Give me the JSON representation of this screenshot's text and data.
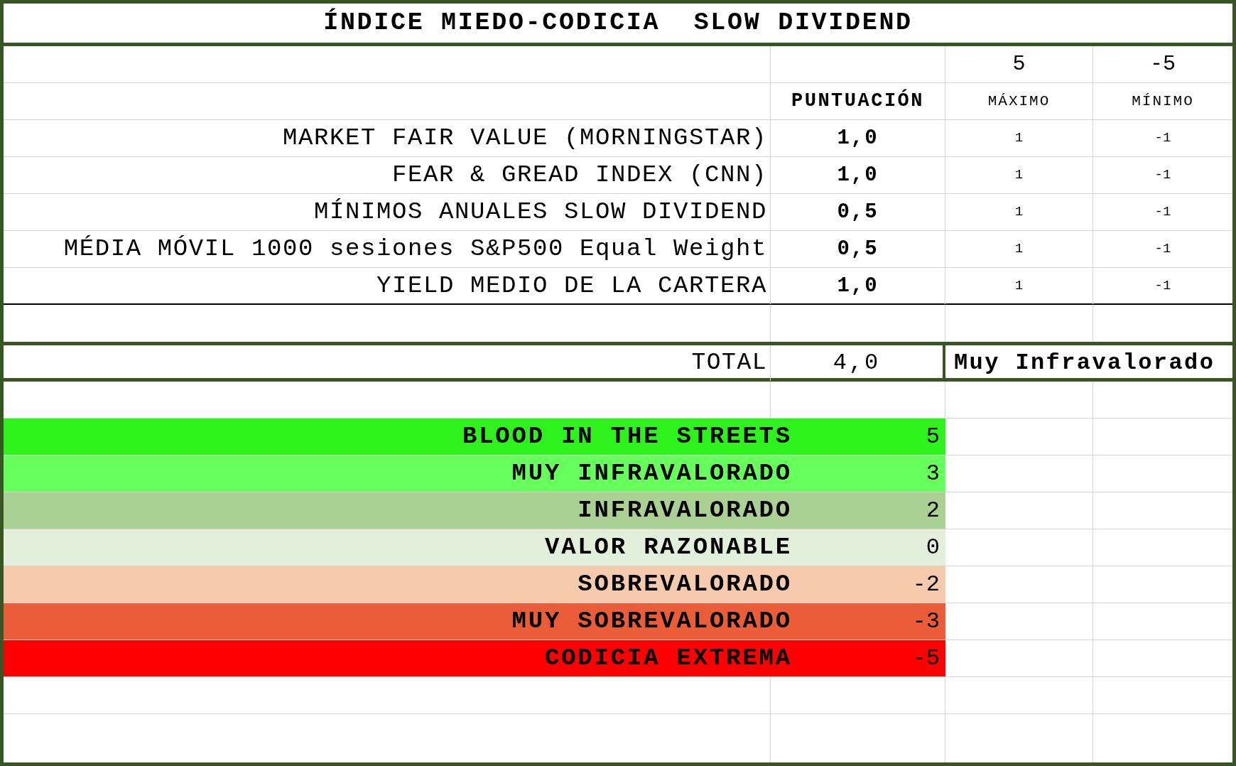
{
  "title": "ÍNDICE MIEDO-CODICIA  SLOW DIVIDEND",
  "header": {
    "max_value": "5",
    "min_value": "-5",
    "score_label": "PUNTUACIÓN",
    "max_label": "MÁXIMO",
    "min_label": "MÍNIMO"
  },
  "indicators": [
    {
      "name": "MARKET FAIR VALUE (MORNINGSTAR)",
      "score": "1,0",
      "max": "1",
      "min": "-1"
    },
    {
      "name": "FEAR & GREAD INDEX (CNN)",
      "score": "1,0",
      "max": "1",
      "min": "-1"
    },
    {
      "name": "MÍNIMOS ANUALES SLOW DIVIDEND",
      "score": "0,5",
      "max": "1",
      "min": "-1"
    },
    {
      "name": "MÉDIA MÓVIL 1000 sesiones S&P500 Equal Weight",
      "score": "0,5",
      "max": "1",
      "min": "-1"
    },
    {
      "name": "YIELD MEDIO DE LA CARTERA",
      "score": "1,0",
      "max": "1",
      "min": "-1"
    }
  ],
  "total": {
    "label": "TOTAL",
    "value": "4,0",
    "verdict": "Muy Infravalorado"
  },
  "scale": [
    {
      "label": "BLOOD IN THE STREETS",
      "value": "5",
      "color": "#2ef21c"
    },
    {
      "label": "MUY INFRAVALORADO",
      "value": "3",
      "color": "#66ff5c"
    },
    {
      "label": "INFRAVALORADO",
      "value": "2",
      "color": "#abd093"
    },
    {
      "label": "VALOR RAZONABLE",
      "value": "0",
      "color": "#e2efdb"
    },
    {
      "label": "SOBREVALORADO",
      "value": "-2",
      "color": "#f6cbad"
    },
    {
      "label": "MUY SOBREVALORADO",
      "value": "-3",
      "color": "#eb5c38"
    },
    {
      "label": "CODICIA EXTREMA",
      "value": "-5",
      "color": "#ff0000"
    }
  ]
}
